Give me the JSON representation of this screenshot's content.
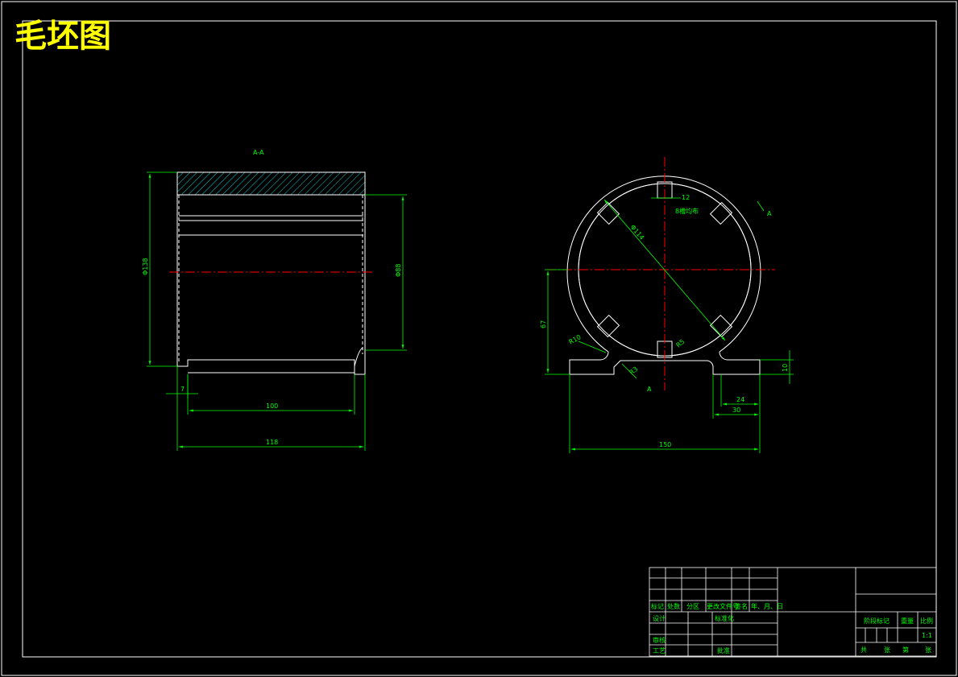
{
  "drawing_title": "毛坯图",
  "section_label": "A-A",
  "left_view": {
    "dim_outer_diameter": "Φ138",
    "dim_inner_diameter": "Φ88",
    "dim_length_100": "100",
    "dim_length_118": "118",
    "dim_offset_7": "7"
  },
  "right_view": {
    "dim_key_width": "12",
    "note_keyways": "8槽均布",
    "dim_diameter_114": "Φ114",
    "dim_radius": "R5",
    "dim_r10": "R10",
    "dim_r3": "R3",
    "dim_height_67": "67",
    "dim_flange_10": "10",
    "dim_width_24": "24",
    "dim_width_30": "30",
    "dim_total_150": "150",
    "section_mark_a_top": "A",
    "section_mark_a_bottom": "A"
  },
  "title_block": {
    "col_labels": [
      "标记",
      "处数",
      "分区",
      "更改文件号",
      "签名",
      "年、月、日"
    ],
    "row_design": "设计",
    "row_standard": "标准化",
    "row_review": "审核",
    "row_process": "工艺",
    "row_approve": "批准",
    "stage_mark": "阶段标记",
    "weight": "重量",
    "scale": "比例",
    "scale_value": "1:1",
    "sheets_total": "共",
    "sheets_unit": "张",
    "sheet_no": "第",
    "sheet_unit": "张"
  },
  "colors": {
    "background": "#000000",
    "outline": "#ffffff",
    "dimension": "#00ff00",
    "centerline": "#ff0000",
    "title": "#ffff00",
    "hatch": "#00ffff"
  }
}
